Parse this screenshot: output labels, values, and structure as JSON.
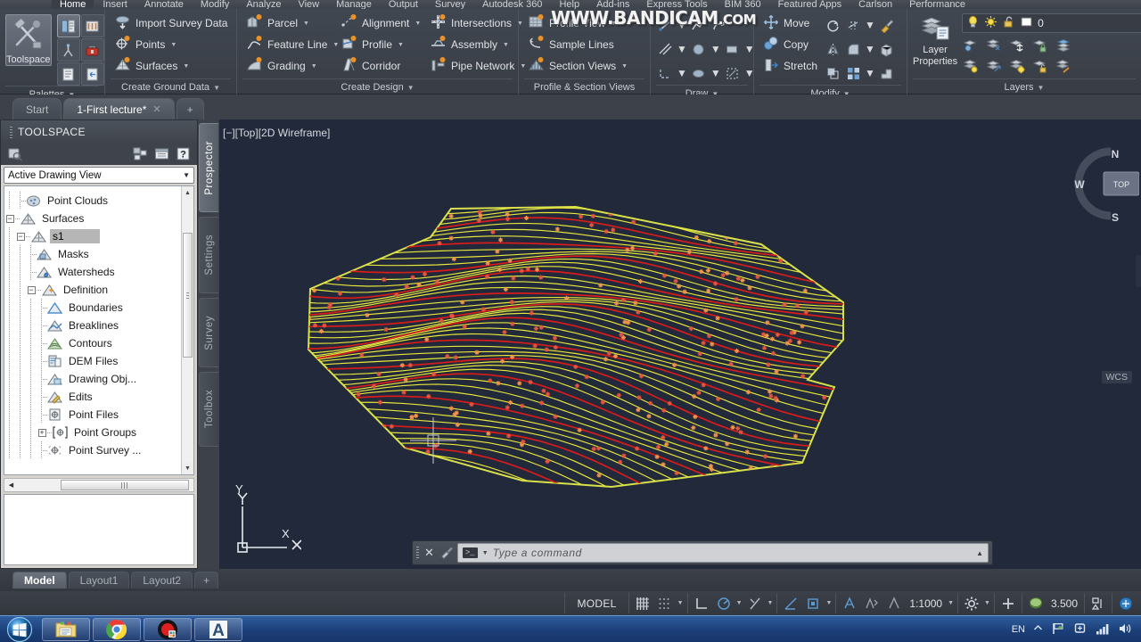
{
  "ribbon": {
    "tabs": [
      {
        "label": "Home",
        "active": true
      },
      {
        "label": "Insert",
        "active": false
      },
      {
        "label": "Annotate",
        "active": false
      },
      {
        "label": "Modify",
        "active": false
      },
      {
        "label": "Analyze",
        "active": false
      },
      {
        "label": "View",
        "active": false
      },
      {
        "label": "Manage",
        "active": false
      },
      {
        "label": "Output",
        "active": false
      },
      {
        "label": "Survey",
        "active": false
      },
      {
        "label": "Autodesk 360",
        "active": false
      },
      {
        "label": "Help",
        "active": false
      },
      {
        "label": "Add-ins",
        "active": false
      },
      {
        "label": "Express Tools",
        "active": false
      },
      {
        "label": "BIM 360",
        "active": false
      },
      {
        "label": "Featured Apps",
        "active": false
      },
      {
        "label": "Carlson",
        "active": false
      },
      {
        "label": "Performance",
        "active": false
      }
    ],
    "panels": {
      "palettes": {
        "label": "Palettes",
        "toolspace": "Toolspace"
      },
      "ground": {
        "label": "Create Ground Data",
        "items": [
          {
            "label": "Import Survey Data",
            "icon": "import-survey-data-icon",
            "dropdown": false
          },
          {
            "label": "Points",
            "icon": "points-icon",
            "dropdown": true
          },
          {
            "label": "Surfaces",
            "icon": "surfaces-icon",
            "dropdown": true
          }
        ]
      },
      "design": {
        "label": "Create Design",
        "col1": [
          {
            "label": "Parcel",
            "icon": "parcel-icon",
            "dropdown": true
          },
          {
            "label": "Feature Line",
            "icon": "feature-line-icon",
            "dropdown": true
          },
          {
            "label": "Grading",
            "icon": "grading-icon",
            "dropdown": true
          }
        ],
        "col2": [
          {
            "label": "Alignment",
            "icon": "alignment-icon",
            "dropdown": true
          },
          {
            "label": "Profile",
            "icon": "profile-icon",
            "dropdown": true
          },
          {
            "label": "Corridor",
            "icon": "corridor-icon",
            "dropdown": false
          }
        ],
        "col3": [
          {
            "label": "Intersections",
            "icon": "intersections-icon",
            "dropdown": true
          },
          {
            "label": "Assembly",
            "icon": "assembly-icon",
            "dropdown": true
          },
          {
            "label": "Pipe Network",
            "icon": "pipe-network-icon",
            "dropdown": true
          }
        ]
      },
      "profile_section": {
        "label": "Profile & Section Views",
        "items": [
          {
            "label": "Profile View",
            "icon": "profile-view-icon",
            "dropdown": true
          },
          {
            "label": "Sample Lines",
            "icon": "sample-lines-icon",
            "dropdown": false
          },
          {
            "label": "Section Views",
            "icon": "section-views-icon",
            "dropdown": true
          }
        ]
      },
      "draw": {
        "label": "Draw"
      },
      "modify": {
        "label": "Modify",
        "items": [
          {
            "label": "Move",
            "icon": "move-icon"
          },
          {
            "label": "Copy",
            "icon": "copy-icon"
          },
          {
            "label": "Stretch",
            "icon": "stretch-icon"
          }
        ]
      },
      "layers": {
        "label": "Layers",
        "properties_label_1": "Layer",
        "properties_label_2": "Properties",
        "current_layer": "0"
      }
    },
    "watermark": {
      "main": "WWW.BANDICAM",
      "suffix": ".COM"
    }
  },
  "filetabs": [
    {
      "label": "Start",
      "active": false,
      "closable": false
    },
    {
      "label": "1-First lecture*",
      "active": true,
      "closable": true
    }
  ],
  "filetab_add": "+",
  "toolspace": {
    "title": "TOOLSPACE",
    "view_selector": "Active Drawing View",
    "tree": [
      {
        "label": "Point Clouds",
        "indent": 2,
        "expander": "none",
        "icon": "point-clouds-icon",
        "selected": false
      },
      {
        "label": "Surfaces",
        "indent": 1,
        "expander": "minus",
        "icon": "surfaces-icon",
        "selected": false
      },
      {
        "label": "s1",
        "indent": 2,
        "expander": "minus",
        "icon": "surface-icon",
        "selected": true
      },
      {
        "label": "Masks",
        "indent": 3,
        "expander": "none",
        "icon": "masks-icon",
        "selected": false
      },
      {
        "label": "Watersheds",
        "indent": 3,
        "expander": "none",
        "icon": "watersheds-icon",
        "selected": false
      },
      {
        "label": "Definition",
        "indent": 3,
        "expander": "minus",
        "icon": "definition-icon",
        "selected": false
      },
      {
        "label": "Boundaries",
        "indent": 4,
        "expander": "none",
        "icon": "boundaries-icon",
        "selected": false
      },
      {
        "label": "Breaklines",
        "indent": 4,
        "expander": "none",
        "icon": "breaklines-icon",
        "selected": false
      },
      {
        "label": "Contours",
        "indent": 4,
        "expander": "none",
        "icon": "contours-icon",
        "selected": false
      },
      {
        "label": "DEM Files",
        "indent": 4,
        "expander": "none",
        "icon": "dem-files-icon",
        "selected": false
      },
      {
        "label": "Drawing Obj...",
        "indent": 4,
        "expander": "none",
        "icon": "drawing-objects-icon",
        "selected": false
      },
      {
        "label": "Edits",
        "indent": 4,
        "expander": "none",
        "icon": "edits-icon",
        "selected": false
      },
      {
        "label": "Point Files",
        "indent": 4,
        "expander": "none",
        "icon": "point-files-icon",
        "selected": false
      },
      {
        "label": "Point Groups",
        "indent": 4,
        "expander": "plus",
        "icon": "point-groups-icon",
        "selected": false
      },
      {
        "label": "Point Survey ...",
        "indent": 4,
        "expander": "none",
        "icon": "point-survey-queries-icon",
        "selected": false
      }
    ],
    "vtabs": [
      {
        "label": "Prospector",
        "active": true
      },
      {
        "label": "Settings",
        "active": false
      },
      {
        "label": "Survey",
        "active": false
      },
      {
        "label": "Toolbox",
        "active": false
      }
    ]
  },
  "canvas": {
    "viewport_label": "[−][Top][2D Wireframe]",
    "ucs_x": "X",
    "ucs_y": "Y",
    "wcs": "WCS",
    "viewcube": {
      "top": "TOP",
      "n": "N",
      "w": "W",
      "s": "S"
    },
    "command": {
      "prompt": ">_",
      "placeholder": "Type a command"
    }
  },
  "model_tabs": [
    {
      "label": "Model",
      "active": true
    },
    {
      "label": "Layout1",
      "active": false
    },
    {
      "label": "Layout2",
      "active": false
    }
  ],
  "model_tab_add": "+",
  "statusbar": {
    "model": "MODEL",
    "scale": "1:1000",
    "lineweight": "3.500"
  },
  "taskbar": {
    "items": [
      {
        "name": "windows-explorer",
        "label": "Windows Explorer"
      },
      {
        "name": "google-chrome",
        "label": "Google Chrome"
      },
      {
        "name": "bandicam",
        "label": "Bandicam"
      },
      {
        "name": "autocad-civil3d",
        "label": "AutoCAD Civil 3D"
      }
    ],
    "tray_language": "EN"
  },
  "colors": {
    "contour_minor": "#e8e83c",
    "contour_major": "#d81b1b",
    "survey_point": "#f2944a",
    "canvas_bg": "#22293a",
    "accent": "#5b9bd5"
  }
}
